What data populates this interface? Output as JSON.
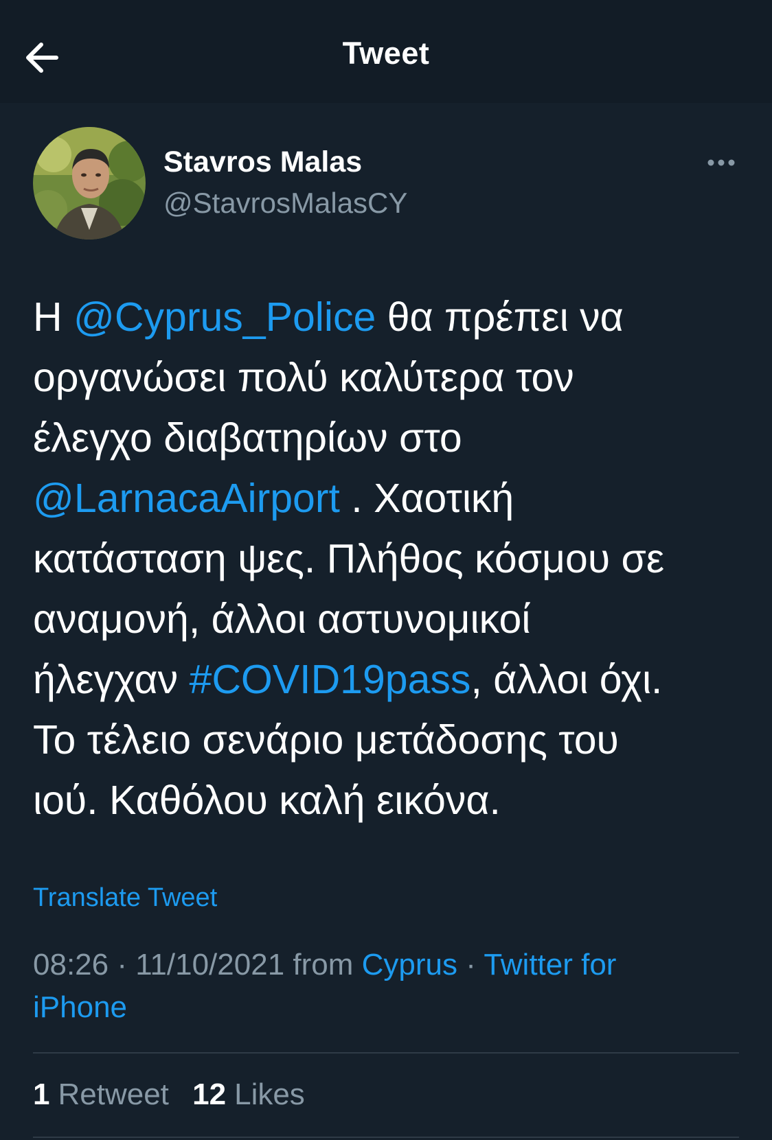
{
  "header": {
    "title": "Tweet",
    "back_icon": "arrow-left-icon"
  },
  "author": {
    "name": "Stavros Malas",
    "handle": "@StavrosMalasCY",
    "more_icon": "more-dots-icon"
  },
  "tweet": {
    "lines": [
      [
        {
          "t": "Η ",
          "link": false
        },
        {
          "t": "@Cyprus_Police",
          "link": true
        },
        {
          "t": " θα πρέπει να",
          "link": false
        }
      ],
      [
        {
          "t": "οργανώσει πολύ καλύτερα τον",
          "link": false
        }
      ],
      [
        {
          "t": "έλεγχο διαβατηρίων στο",
          "link": false
        }
      ],
      [
        {
          "t": "@LarnacaAirport",
          "link": true
        },
        {
          "t": " . Χαοτική",
          "link": false
        }
      ],
      [
        {
          "t": "κατάσταση ψες. Πλήθος κόσμου σε",
          "link": false
        }
      ],
      [
        {
          "t": "αναμονή, άλλοι αστυνομικοί",
          "link": false
        }
      ],
      [
        {
          "t": "ήλεγχαν ",
          "link": false
        },
        {
          "t": "#COVID19pass",
          "link": true
        },
        {
          "t": ", άλλοι όχι.",
          "link": false
        }
      ],
      [
        {
          "t": "Το τέλειο σενάριο μετάδοσης του",
          "link": false
        }
      ],
      [
        {
          "t": "ιού. Καθόλου καλή εικόνα.",
          "link": false
        }
      ]
    ],
    "translate_label": "Translate Tweet"
  },
  "meta": {
    "time": "08:26",
    "sep1": " · ",
    "date": "11/10/2021",
    "from_label": " from ",
    "location": "Cyprus",
    "sep2": " · ",
    "client_part1": "Twitter for",
    "client_part2": "iPhone"
  },
  "stats": {
    "retweets_count": "1",
    "retweets_label": "Retweet",
    "likes_count": "12",
    "likes_label": "Likes"
  },
  "colors": {
    "background": "#15202b",
    "header_background": "#121c26",
    "accent": "#1d9bf0",
    "secondary_text": "#8899a6",
    "divider": "#2f3b47"
  }
}
